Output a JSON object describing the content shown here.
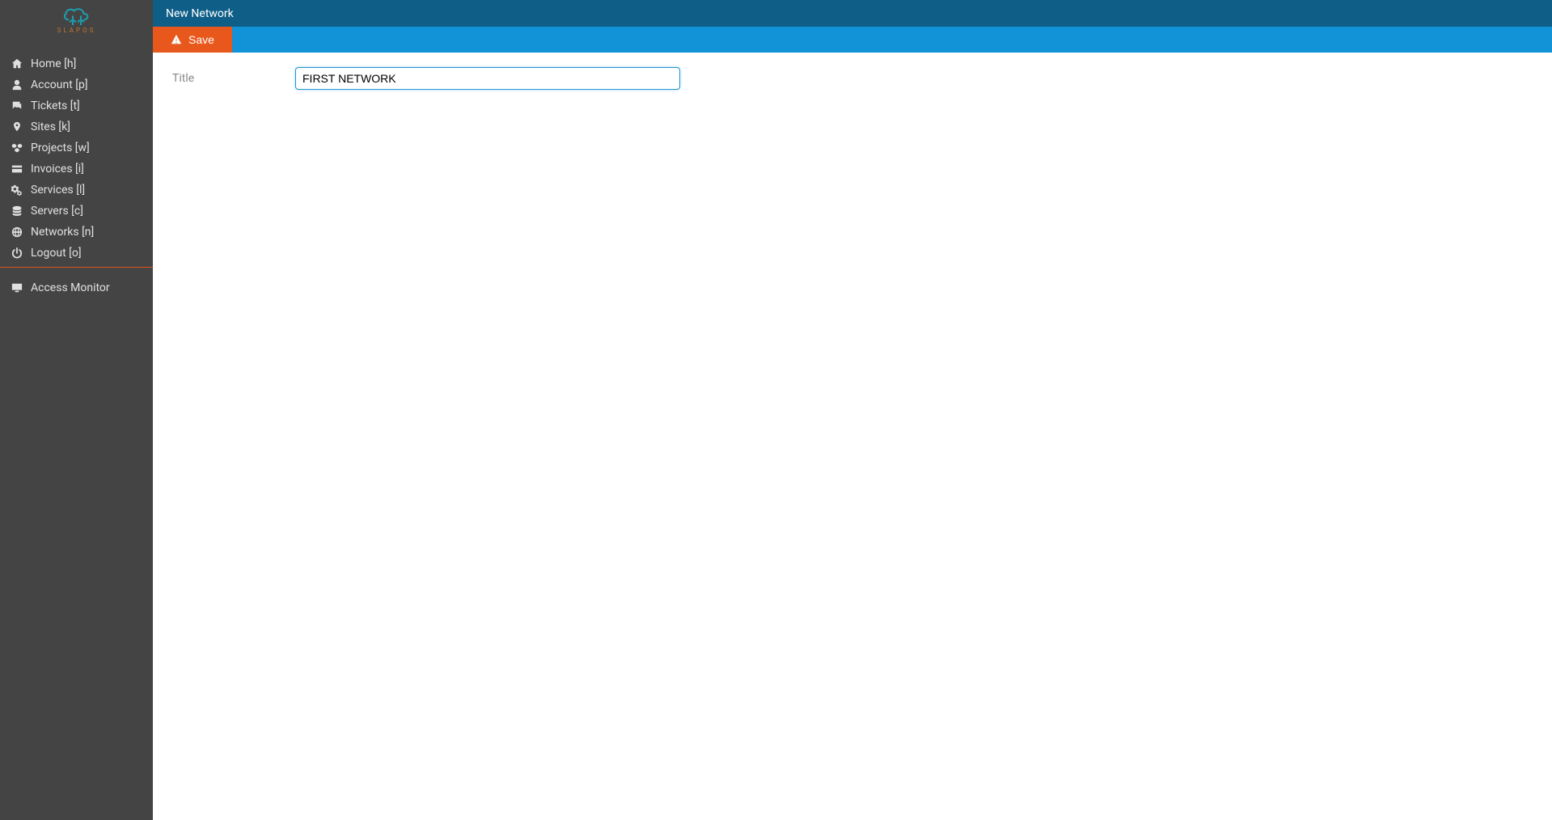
{
  "logo": {
    "text": "SLAPOS"
  },
  "sidebar": {
    "items": [
      {
        "label": "Home [h]",
        "icon": "home"
      },
      {
        "label": "Account [p]",
        "icon": "user"
      },
      {
        "label": "Tickets [t]",
        "icon": "comments"
      },
      {
        "label": "Sites [k]",
        "icon": "pin"
      },
      {
        "label": "Projects [w]",
        "icon": "cubes"
      },
      {
        "label": "Invoices [i]",
        "icon": "card"
      },
      {
        "label": "Services [l]",
        "icon": "cogs"
      },
      {
        "label": "Servers [c]",
        "icon": "database"
      },
      {
        "label": "Networks [n]",
        "icon": "globe"
      },
      {
        "label": "Logout [o]",
        "icon": "power"
      }
    ],
    "secondary": [
      {
        "label": "Access Monitor",
        "icon": "desktop"
      }
    ]
  },
  "header": {
    "title": "New Network"
  },
  "toolbar": {
    "save_label": "Save"
  },
  "form": {
    "title_label": "Title",
    "title_value": "FIRST NETWORK"
  }
}
